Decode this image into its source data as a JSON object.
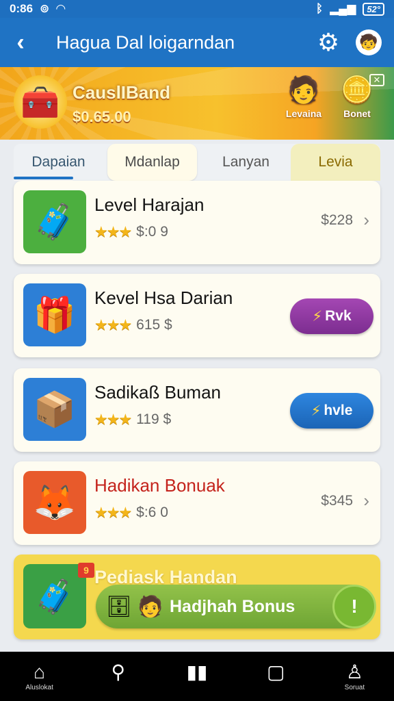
{
  "status": {
    "time": "0:86",
    "battery": "52°"
  },
  "app_bar": {
    "title": "Hagua Dal loigarndan"
  },
  "banner": {
    "title": "CauslIBand",
    "amount": "$0.65.00",
    "chips": [
      {
        "label": "Levaina"
      },
      {
        "label": "Bonet"
      }
    ]
  },
  "tabs": [
    {
      "label": "Dapaian"
    },
    {
      "label": "Mdanlap"
    },
    {
      "label": "Lanyan"
    },
    {
      "label": "Levia"
    }
  ],
  "items": [
    {
      "name": "Level Harajan",
      "rating": 3,
      "meta": "$:0 9",
      "price": "$228",
      "icon": "toolbox"
    },
    {
      "name": "Kevel Hsa Darian",
      "rating": 3,
      "meta": "615 $",
      "button": "Rvk",
      "icon": "gift"
    },
    {
      "name": "Sadikaß Buman",
      "rating": 3,
      "meta": "119 $",
      "button": "hvle",
      "icon": "gift-box"
    },
    {
      "name": "Hadikan Bonuak",
      "rating": 3,
      "meta": "$:6 0",
      "price": "$345",
      "icon": "fox"
    }
  ],
  "promo": {
    "name": "Pediask Handan",
    "badge": "9",
    "button_label": "Hadjhah Bonus",
    "go": "!"
  },
  "bottom_nav": [
    {
      "label": "Aluslokat",
      "icon": "home-icon"
    },
    {
      "label": "",
      "icon": "search-icon"
    },
    {
      "label": "",
      "icon": "book-icon"
    },
    {
      "label": "",
      "icon": "calendar-icon"
    },
    {
      "label": "Soruat",
      "icon": "profile-icon"
    }
  ]
}
